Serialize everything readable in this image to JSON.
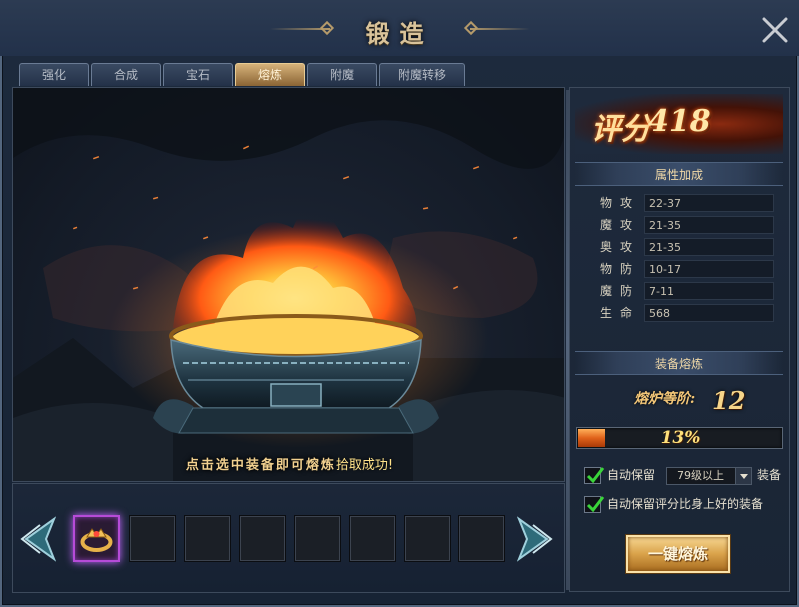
{
  "window": {
    "title": "锻造"
  },
  "tabs": [
    {
      "label": "强化",
      "active": false
    },
    {
      "label": "合成",
      "active": false
    },
    {
      "label": "宝石",
      "active": false
    },
    {
      "label": "熔炼",
      "active": true
    },
    {
      "label": "附魔",
      "active": false
    },
    {
      "label": "附魔转移",
      "active": false
    }
  ],
  "scene": {
    "hint": "点击选中装备即可熔炼",
    "sub_hint": "拾取成功!"
  },
  "panel": {
    "score_label": "评分",
    "score_value": "418",
    "attributes_header": "属性加成",
    "attributes": [
      {
        "name": "物攻",
        "value": "22-37"
      },
      {
        "name": "魔攻",
        "value": "21-35"
      },
      {
        "name": "奥攻",
        "value": "21-35"
      },
      {
        "name": "物防",
        "value": "10-17"
      },
      {
        "name": "魔防",
        "value": "7-11"
      },
      {
        "name": "生命",
        "value": "568"
      }
    ],
    "smelt_header": "装备熔炼",
    "furnace_level_label": "熔炉等阶:",
    "furnace_level_value": "12",
    "progress": {
      "percent": 13,
      "text": "13%"
    },
    "auto_keep": {
      "label": "自动保留",
      "checked": true,
      "select_value": "79级以上",
      "suffix": "装备"
    },
    "auto_keep_better": {
      "label": "自动保留评分比身上好的装备",
      "checked": true
    },
    "smelt_button": "一键熔炼"
  },
  "slots": {
    "count": 8,
    "selected_index": 0,
    "filled": [
      true,
      false,
      false,
      false,
      false,
      false,
      false,
      false
    ]
  },
  "icons": {
    "close": "close-icon",
    "left_arrow": "arrow-left-icon",
    "right_arrow": "arrow-right-icon",
    "ring": "ring-icon",
    "check": "check-icon"
  },
  "colors": {
    "accent": "#d6b27a",
    "progress": "#e0621a",
    "selected_slot": "#b64bd8"
  }
}
